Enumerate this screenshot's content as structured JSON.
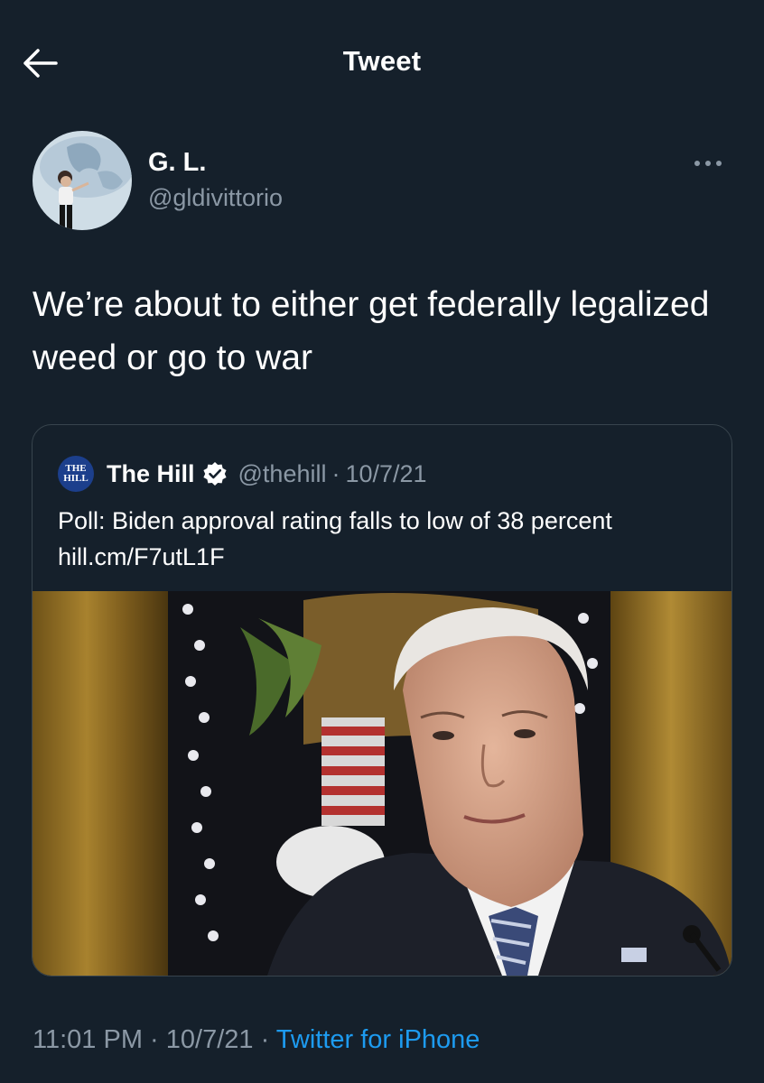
{
  "header": {
    "title": "Tweet"
  },
  "tweet": {
    "author_name": "G. L.",
    "author_handle": "@gldivittorio",
    "text": "We’re about to either get federally legalized weed or go to war"
  },
  "quote": {
    "logo_text_line1": "THE",
    "logo_text_line2": "HILL",
    "author_name": "The Hill",
    "author_handle": "@thehill",
    "separator": "·",
    "date": "10/7/21",
    "text": "Poll: Biden approval rating falls to low of 38 percent hill.cm/F7utL1F"
  },
  "meta": {
    "time": "11:01 PM",
    "separator1": " · ",
    "date": "10/7/21",
    "separator2": " · ",
    "source": "Twitter for iPhone"
  },
  "colors": {
    "background": "#15202b",
    "secondary_text": "#8b98a5",
    "link": "#1d9bf0",
    "border": "#38444d"
  },
  "icons": [
    "back-arrow-icon",
    "more-options-icon",
    "verified-badge-icon"
  ]
}
